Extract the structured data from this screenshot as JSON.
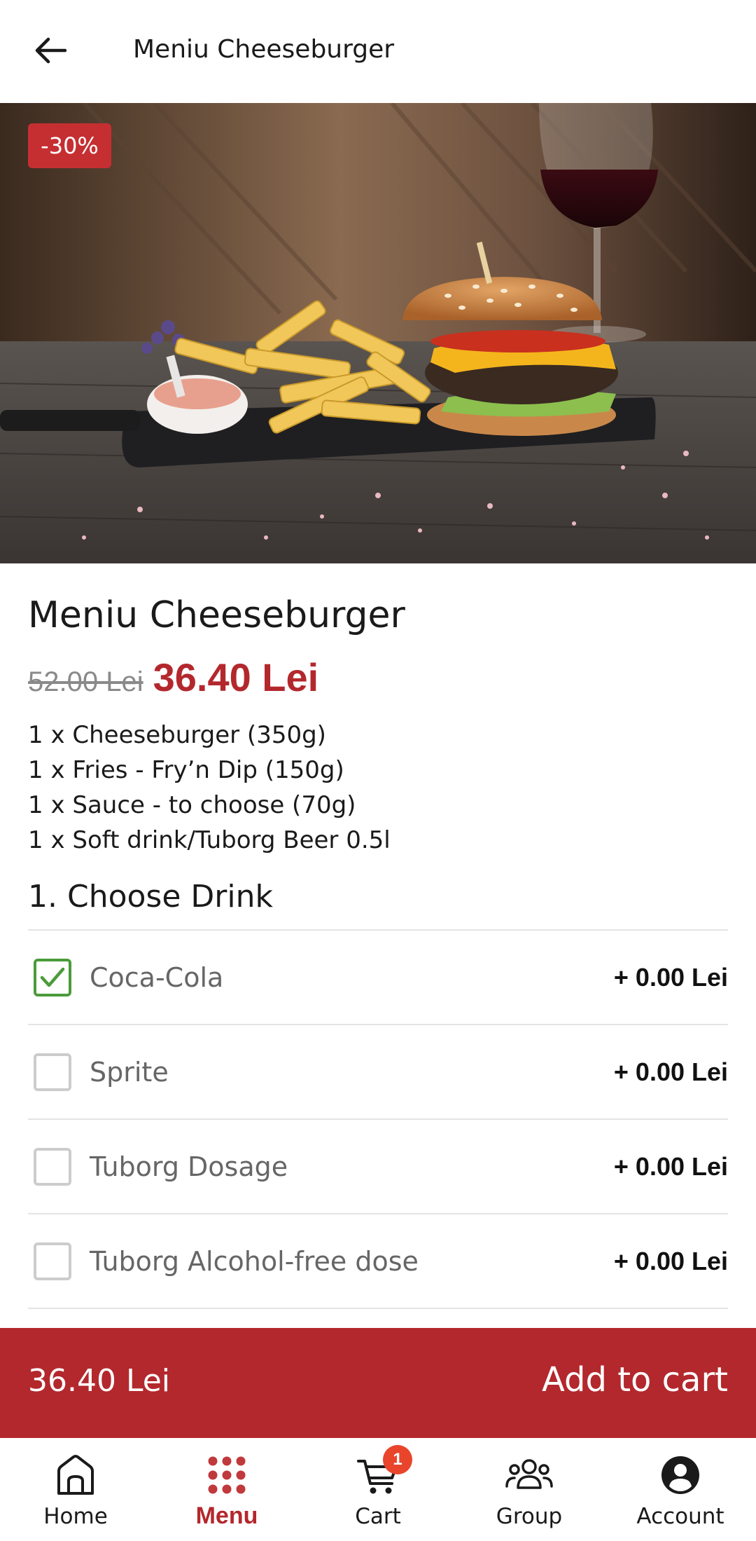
{
  "header": {
    "title": "Meniu Cheeseburger",
    "back_icon": "arrow-left-icon"
  },
  "hero": {
    "discount_badge": "-30%",
    "badge_color": "#c62f32"
  },
  "product": {
    "title": "Meniu Cheeseburger",
    "old_price": "52.00 Lei",
    "new_price": "36.40 Lei",
    "description": [
      "1 x Cheeseburger (350g)",
      "1 x Fries - Fry’n Dip (150g)",
      "1 x Sauce - to choose (70g)",
      "1 x Soft drink/Tuborg Beer 0.5l"
    ]
  },
  "drink_section": {
    "title": "1. Choose Drink",
    "options": [
      {
        "label": "Coca-Cola",
        "price": "+ 0.00 Lei",
        "checked": true
      },
      {
        "label": "Sprite",
        "price": "+ 0.00 Lei",
        "checked": false
      },
      {
        "label": "Tuborg Dosage",
        "price": "+ 0.00 Lei",
        "checked": false
      },
      {
        "label": "Tuborg Alcohol-free dose",
        "price": "+ 0.00 Lei",
        "checked": false
      }
    ]
  },
  "cart_bar": {
    "total": "36.40 Lei",
    "action": "Add to cart",
    "color": "#b3282d"
  },
  "nav": {
    "items": [
      {
        "label": "Home",
        "icon": "home-icon",
        "active": false
      },
      {
        "label": "Menu",
        "icon": "grid-dots-icon",
        "active": true
      },
      {
        "label": "Cart",
        "icon": "cart-icon",
        "active": false,
        "badge": "1"
      },
      {
        "label": "Group",
        "icon": "group-icon",
        "active": false
      },
      {
        "label": "Account",
        "icon": "account-icon",
        "active": false
      }
    ],
    "active_color": "#b3282d"
  }
}
